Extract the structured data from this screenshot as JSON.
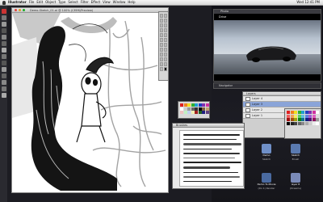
{
  "menubar": {
    "app": "Illustrator",
    "items": [
      "File",
      "Edit",
      "Object",
      "Type",
      "Select",
      "Filter",
      "Effect",
      "View",
      "Window",
      "Help"
    ],
    "clock": "Wed 12:41 PM"
  },
  "document": {
    "title": "Demo-Sketch_01.ai @ 100% (CMYK/Preview)"
  },
  "photo_window": {
    "title": "Photo",
    "caption": "Drive"
  },
  "panels": {
    "navigator_title": "Navigator",
    "layers_title": "Layers",
    "swatches_title": "Swatches",
    "brushes_title": "Brushes",
    "color_title": "Color",
    "layers": [
      {
        "name": "Layer 4",
        "selected": false
      },
      {
        "name": "Layer 3",
        "selected": true
      },
      {
        "name": "Layer 2",
        "selected": false
      },
      {
        "name": "Layer 1",
        "selected": false
      }
    ]
  },
  "desktop_icons": [
    {
      "label": "Demo",
      "sub": "Sketch"
    },
    {
      "label": "Sketch",
      "sub": "Brush"
    },
    {
      "label": "Demo To Movie",
      "sub": "(Do 1) Render"
    },
    {
      "label": "layer 8",
      "sub": "(Dreams)"
    }
  ],
  "colors": {
    "accent": "#8aa4d8",
    "sky": "#b7c2cf",
    "car": "#1a1a1c"
  }
}
